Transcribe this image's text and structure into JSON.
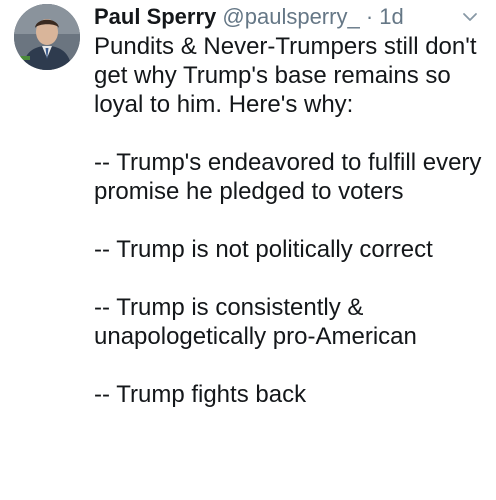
{
  "tweet": {
    "author": {
      "name": "Paul Sperry",
      "handle": "@paulsperry_",
      "separator": "·",
      "time": "1d"
    },
    "icons": {
      "avatar": "profile-photo",
      "menu": "chevron-down-icon"
    },
    "paragraphs": [
      "Pundits & Never-Trumpers still don't get why Trump's base remains so loyal to him. Here's why:",
      "-- Trump's endeavored to fulfill every promise he pledged to voters",
      "-- Trump is not politically correct",
      "-- Trump is consistently & unapologetically pro-American",
      "-- Trump fights back"
    ],
    "colors": {
      "text": "#14171a",
      "secondary": "#657786"
    }
  }
}
